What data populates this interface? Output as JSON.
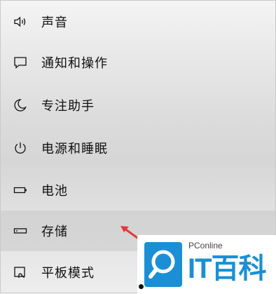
{
  "nav": {
    "items": [
      {
        "label": "声音",
        "icon": "speaker-icon"
      },
      {
        "label": "通知和操作",
        "icon": "message-icon"
      },
      {
        "label": "专注助手",
        "icon": "moon-icon"
      },
      {
        "label": "电源和睡眠",
        "icon": "power-icon"
      },
      {
        "label": "电池",
        "icon": "battery-icon"
      },
      {
        "label": "存储",
        "icon": "storage-drive-icon",
        "selected": true
      },
      {
        "label": "平板模式",
        "icon": "tablet-mode-icon"
      }
    ]
  },
  "watermark": {
    "site": "PConline",
    "brand": "IT百科"
  },
  "colors": {
    "arrow": "#e53935",
    "brand_blue": "#1b8fd6"
  }
}
